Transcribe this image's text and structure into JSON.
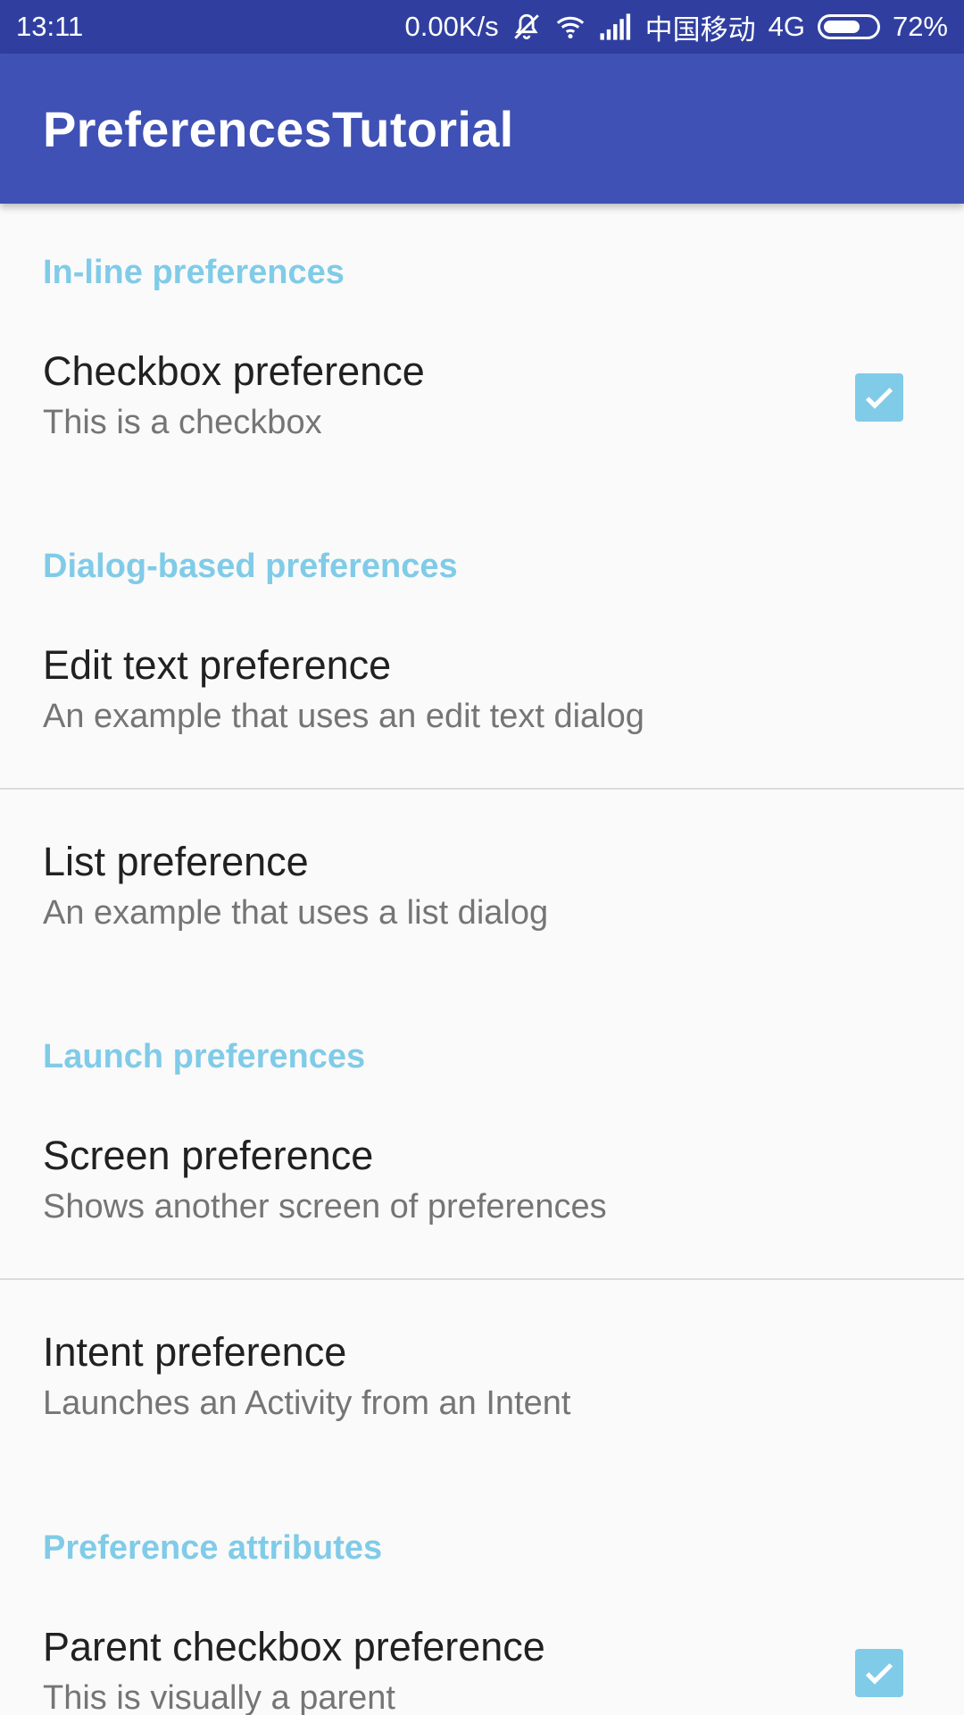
{
  "status_bar": {
    "time": "13:11",
    "speed": "0.00K/s",
    "carrier": "中国移动",
    "network": "4G",
    "battery": "72%",
    "battery_level": 0.72
  },
  "app_bar": {
    "title": "PreferencesTutorial"
  },
  "categories": {
    "inline": "In-line preferences",
    "dialog": "Dialog-based preferences",
    "launch": "Launch preferences",
    "attributes": "Preference attributes"
  },
  "prefs": {
    "checkbox": {
      "title": "Checkbox preference",
      "summary": "This is a checkbox",
      "checked": true
    },
    "edit_text": {
      "title": "Edit text preference",
      "summary": "An example that uses an edit text dialog"
    },
    "list": {
      "title": "List preference",
      "summary": "An example that uses a list dialog"
    },
    "screen": {
      "title": "Screen preference",
      "summary": "Shows another screen of preferences"
    },
    "intent": {
      "title": "Intent preference",
      "summary": "Launches an Activity from an Intent"
    },
    "parent_checkbox": {
      "title": "Parent checkbox preference",
      "summary": "This is visually a parent",
      "checked": true
    }
  },
  "colors": {
    "status_bar": "#303f9f",
    "app_bar": "#3f51b5",
    "accent": "#80cbe8"
  }
}
